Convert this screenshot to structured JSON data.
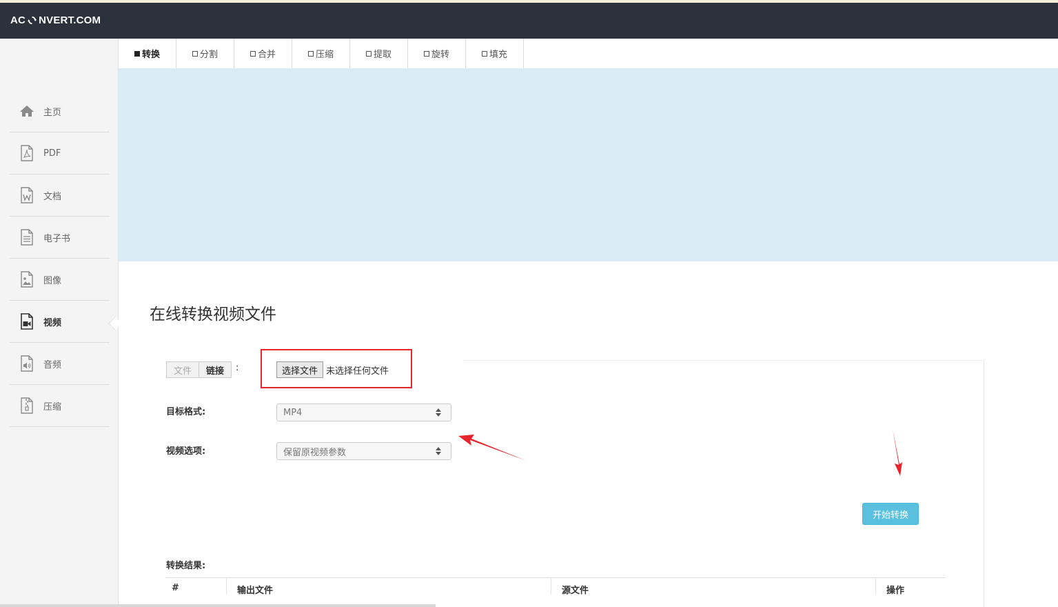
{
  "header": {
    "logo_left": "AC",
    "logo_right": "NVERT.COM"
  },
  "sidebar": {
    "items": [
      {
        "label": "主页",
        "icon": "home-icon",
        "active": false
      },
      {
        "label": "PDF",
        "icon": "pdf-file-icon",
        "active": false
      },
      {
        "label": "文档",
        "icon": "word-file-icon",
        "active": false
      },
      {
        "label": "电子书",
        "icon": "ebook-file-icon",
        "active": false
      },
      {
        "label": "图像",
        "icon": "image-file-icon",
        "active": false
      },
      {
        "label": "视频",
        "icon": "video-file-icon",
        "active": true
      },
      {
        "label": "音频",
        "icon": "audio-file-icon",
        "active": false
      },
      {
        "label": "压缩",
        "icon": "archive-file-icon",
        "active": false
      }
    ]
  },
  "tabs": [
    {
      "label": "转换",
      "active": true
    },
    {
      "label": "分割",
      "active": false
    },
    {
      "label": "合并",
      "active": false
    },
    {
      "label": "压缩",
      "active": false
    },
    {
      "label": "提取",
      "active": false
    },
    {
      "label": "旋转",
      "active": false
    },
    {
      "label": "填充",
      "active": false
    }
  ],
  "main": {
    "title": "在线转换视频文件",
    "source_toggle": {
      "file": "文件",
      "link": "链接",
      "colon": ":"
    },
    "file_input": {
      "button": "选择文件",
      "status": "未选择任何文件"
    },
    "target_format": {
      "label": "目标格式:",
      "value": "MP4"
    },
    "video_options": {
      "label": "视频选项:",
      "value": "保留原视频参数"
    },
    "start_button": "开始转换",
    "results": {
      "label": "转换结果:",
      "columns": [
        "#",
        "输出文件",
        "源文件",
        "操作"
      ]
    }
  },
  "colors": {
    "header_bg": "#2b323b",
    "banner_bg": "#d9ebf5",
    "accent_button": "#5bc0de",
    "annotation_red": "#e8242a"
  }
}
